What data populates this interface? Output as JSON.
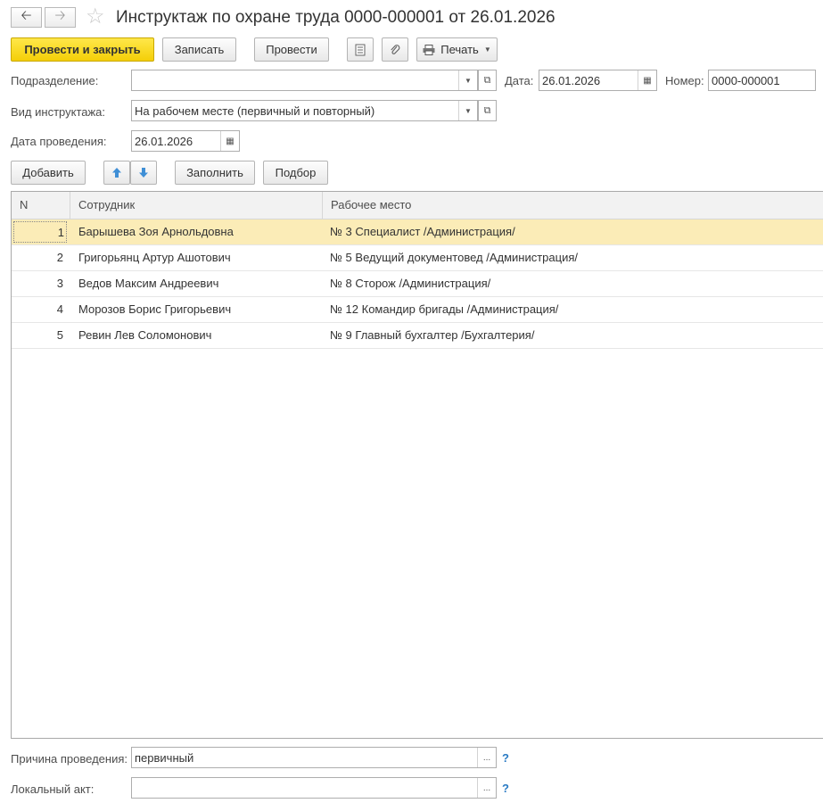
{
  "title": "Инструктаж по охране труда 0000-000001 от 26.01.2026",
  "toolbar": {
    "post_close": "Провести и закрыть",
    "save": "Записать",
    "post": "Провести",
    "print": "Печать"
  },
  "form": {
    "division_label": "Подразделение:",
    "division_value": "",
    "date_label": "Дата:",
    "date_value": "26.01.2026",
    "number_label": "Номер:",
    "number_value": "0000-000001",
    "type_label": "Вид инструктажа:",
    "type_value": "На рабочем месте (первичный и повторный)",
    "held_date_label": "Дата проведения:",
    "held_date_value": "26.01.2026",
    "reason_label": "Причина проведения:",
    "reason_value": "первичный",
    "local_act_label": "Локальный акт:",
    "local_act_value": "",
    "help": "?"
  },
  "table_toolbar": {
    "add": "Добавить",
    "fill": "Заполнить",
    "select": "Подбор"
  },
  "table": {
    "columns": [
      "N",
      "Сотрудник",
      "Рабочее место"
    ],
    "rows": [
      {
        "n": "1",
        "employee": "Барышева Зоя Арнольдовна",
        "workplace": "№ 3 Специалист /Администрация/"
      },
      {
        "n": "2",
        "employee": "Григорьянц Артур Ашотович",
        "workplace": "№ 5 Ведущий документовед /Администрация/"
      },
      {
        "n": "3",
        "employee": "Ведов Максим Андреевич",
        "workplace": "№ 8 Сторож /Администрация/"
      },
      {
        "n": "4",
        "employee": "Морозов Борис Григорьевич",
        "workplace": "№ 12 Командир бригады /Администрация/"
      },
      {
        "n": "5",
        "employee": "Ревин Лев Соломонович",
        "workplace": "№ 9 Главный бухгалтер /Бухгалтерия/"
      }
    ],
    "selected_row": 0
  },
  "colors": {
    "primary_button": "#f4cf07",
    "selected_row": "#fbecb7",
    "help": "#2a7bc4",
    "arrow": "#3f8fd6"
  }
}
